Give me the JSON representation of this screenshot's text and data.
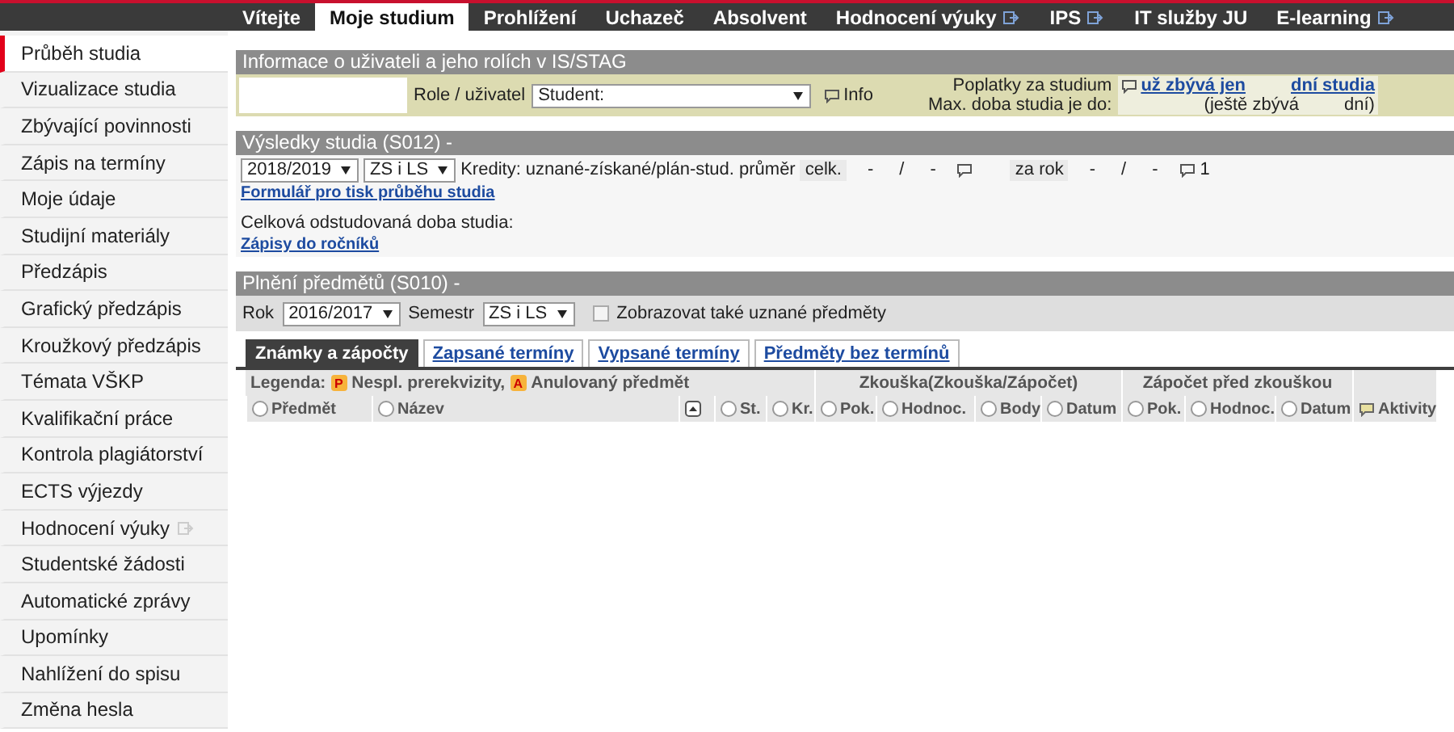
{
  "top_nav": [
    {
      "label": "Vítejte",
      "selected": false,
      "external": false
    },
    {
      "label": "Moje studium",
      "selected": true,
      "external": false
    },
    {
      "label": "Prohlížení",
      "selected": false,
      "external": false
    },
    {
      "label": "Uchazeč",
      "selected": false,
      "external": false
    },
    {
      "label": "Absolvent",
      "selected": false,
      "external": false
    },
    {
      "label": "Hodnocení výuky",
      "selected": false,
      "external": true
    },
    {
      "label": "IPS",
      "selected": false,
      "external": true
    },
    {
      "label": "IT služby JU",
      "selected": false,
      "external": false
    },
    {
      "label": "E-learning",
      "selected": false,
      "external": true
    }
  ],
  "sidebar": {
    "items": [
      {
        "label": "Průběh studia",
        "selected": true,
        "external": false
      },
      {
        "label": "Vizualizace studia",
        "selected": false,
        "external": false
      },
      {
        "label": "Zbývající povinnosti",
        "selected": false,
        "external": false
      },
      {
        "label": "Zápis na termíny",
        "selected": false,
        "external": false
      },
      {
        "label": "Moje údaje",
        "selected": false,
        "external": false
      },
      {
        "label": "Studijní materiály",
        "selected": false,
        "external": false
      },
      {
        "label": "Předzápis",
        "selected": false,
        "external": false
      },
      {
        "label": "Grafický předzápis",
        "selected": false,
        "external": false
      },
      {
        "label": "Kroužkový předzápis",
        "selected": false,
        "external": false
      },
      {
        "label": "Témata VŠKP",
        "selected": false,
        "external": false
      },
      {
        "label": "Kvalifikační práce",
        "selected": false,
        "external": false
      },
      {
        "label": "Kontrola plagiátorství",
        "selected": false,
        "external": false
      },
      {
        "label": "ECTS výjezdy",
        "selected": false,
        "external": false
      },
      {
        "label": "Hodnocení výuky",
        "selected": false,
        "external": true
      },
      {
        "label": "Studentské žádosti",
        "selected": false,
        "external": false
      },
      {
        "label": "Automatické zprávy",
        "selected": false,
        "external": false
      },
      {
        "label": "Upomínky",
        "selected": false,
        "external": false
      },
      {
        "label": "Nahlížení do spisu",
        "selected": false,
        "external": false
      },
      {
        "label": "Změna hesla",
        "selected": false,
        "external": false
      }
    ]
  },
  "user_info": {
    "title": "Informace o uživateli a jeho rolích v IS/STAG",
    "role_label": "Role / uživatel",
    "role_value": "Student:",
    "info_label": "Info",
    "fees_label": "Poplatky za studium",
    "fees_link": "už zbývá jen",
    "fees_link_end": "dní studia",
    "max_label": "Max. doba studia je do:",
    "remaining_start": "(ještě zbývá",
    "remaining_end": "dní)"
  },
  "results": {
    "title": "Výsledky studia (S012) -",
    "year": "2018/2019",
    "semester": "ZS i LS",
    "credits_label": "Kredity: uznané-získané/plán-stud. průměr",
    "total_label": "celk.",
    "total_values": [
      "-",
      "/",
      "-"
    ],
    "year_label": "za rok",
    "year_values": [
      "-",
      "/",
      "-"
    ],
    "year_count": "1",
    "print_link": "Formulář pro tisk průběhu studia",
    "duration_label": "Celková odstudovaná doba studia:",
    "enrol_link": "Zápisy do ročníků"
  },
  "subjects": {
    "title": "Plnění předmětů (S010) -",
    "year_label": "Rok",
    "year": "2016/2017",
    "semester_label": "Semestr",
    "semester": "ZS i LS",
    "show_recognized": {
      "label": "Zobrazovat také uznané předměty",
      "checked": false
    },
    "tabs": [
      {
        "label": "Známky a zápočty",
        "selected": true
      },
      {
        "label": "Zapsané termíny",
        "selected": false
      },
      {
        "label": "Vypsané termíny",
        "selected": false
      },
      {
        "label": "Předměty bez termínů",
        "selected": false
      }
    ],
    "legend_label": "Legenda:",
    "legend": [
      {
        "mark": "P",
        "text": "Nespl. prerekvizity,"
      },
      {
        "mark": "A",
        "text": "Anulovaný předmět"
      }
    ],
    "groups": [
      "Zkouška(Zkouška/Zápočet)",
      "Zápočet před zkouškou"
    ],
    "columns": [
      {
        "label": "Předmět",
        "kind": "sort"
      },
      {
        "label": "Název",
        "kind": "sort"
      },
      {
        "kind": "toggle"
      },
      {
        "label": "St.",
        "kind": "sort"
      },
      {
        "label": "Kr.",
        "kind": "sort"
      },
      {
        "label": "Pok.",
        "kind": "sort"
      },
      {
        "label": "Hodnoc.",
        "kind": "sort"
      },
      {
        "label": "Body",
        "kind": "sort"
      },
      {
        "label": "Datum",
        "kind": "sort"
      },
      {
        "label": "Pok.",
        "kind": "sort"
      },
      {
        "label": "Hodnoc.",
        "kind": "sort"
      },
      {
        "label": "Datum",
        "kind": "sort"
      },
      {
        "label": "Aktivity",
        "kind": "comment"
      }
    ]
  }
}
